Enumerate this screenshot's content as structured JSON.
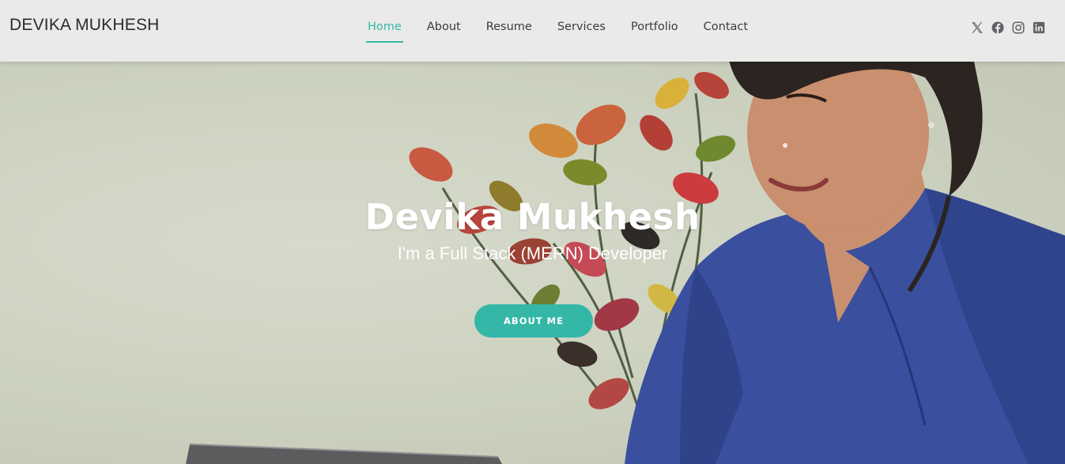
{
  "header": {
    "logo": "DEVIKA MUKHESH",
    "nav": [
      {
        "label": "Home",
        "active": true
      },
      {
        "label": "About"
      },
      {
        "label": "Resume"
      },
      {
        "label": "Services"
      },
      {
        "label": "Portfolio"
      },
      {
        "label": "Contact"
      }
    ],
    "social": [
      "x-twitter-icon",
      "facebook-icon",
      "instagram-icon",
      "linkedin-icon"
    ]
  },
  "hero": {
    "title": "Devika Mukhesh",
    "subtitle": "I'm a Full Stack (MERN) Developer",
    "cta_label": "ABOUT ME"
  },
  "colors": {
    "accent": "#34b7a7",
    "header_bg": "#eaeae8",
    "text_dark": "#3b3b3b"
  }
}
